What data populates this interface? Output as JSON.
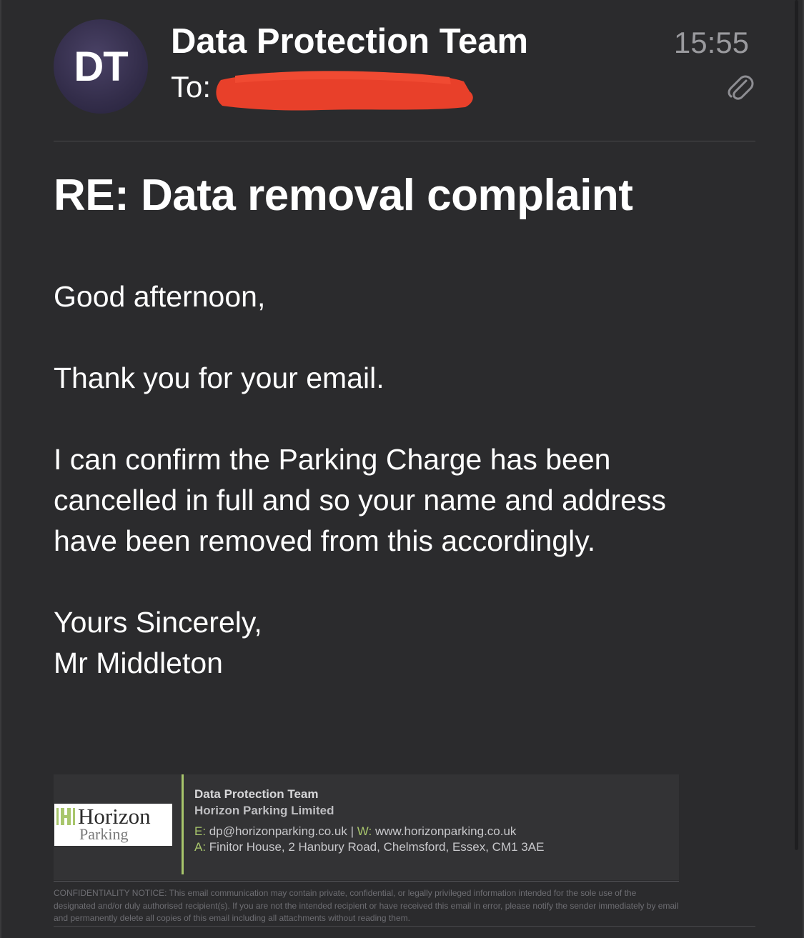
{
  "header": {
    "avatar_initials": "DT",
    "sender_name": "Data Protection Team",
    "to_label": "To:",
    "time": "15:55",
    "attachment_icon": "paperclip-icon"
  },
  "email": {
    "subject": "RE: Data removal complaint",
    "greeting": "Good afternoon,",
    "thanks": "Thank you for your email.",
    "body_line_1": "I can confirm the Parking Charge has been",
    "body_line_2": "cancelled in full and so your name and address",
    "body_line_3": "have been removed from this accordingly.",
    "signoff": "Yours Sincerely,",
    "signer": "Mr Middleton"
  },
  "signature": {
    "logo_text_1": "Horizon",
    "logo_text_2": "Parking",
    "team": "Data Protection Team",
    "company": "Horizon Parking Limited",
    "email_label": "E:",
    "email": "dp@horizonparking.co.uk",
    "separator": "|",
    "web_label": "W:",
    "web": "www.horizonparking.co.uk",
    "address_label": "A:",
    "address": "Finitor House, 2 Hanbury Road, Chelmsford, Essex, CM1 3AE",
    "accent_color": "#a8c66c"
  },
  "confidentiality": "CONFIDENTIALITY NOTICE: This email communication may contain private, confidential, or legally privileged information intended for the sole use of the designated and/or duly authorised recipient(s). If you are not the intended recipient or have received this email in error, please notify the sender immediately by email and permanently delete all copies of this email including all attachments without reading them.",
  "colors": {
    "background": "#2b2b2d",
    "text": "#ffffff",
    "muted": "#9a9a9e",
    "redaction": "#e8402a"
  }
}
